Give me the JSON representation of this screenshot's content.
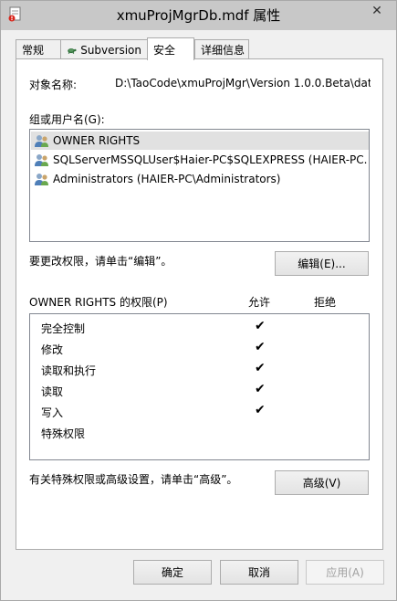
{
  "window": {
    "title": "xmuProjMgrDb.mdf 属性",
    "close_glyph": "✕"
  },
  "tabs": [
    {
      "label": "常规"
    },
    {
      "label": "Subversion"
    },
    {
      "label": "安全",
      "active": true
    },
    {
      "label": "详细信息"
    }
  ],
  "security": {
    "object_label": "对象名称:",
    "object_value": "D:\\TaoCode\\xmuProjMgr\\Version 1.0.0.Beta\\dat",
    "groups_label": "组或用户名(G):",
    "users": [
      {
        "name": "OWNER RIGHTS",
        "selected": true
      },
      {
        "name": "SQLServerMSSQLUser$Haier-PC$SQLEXPRESS (HAIER-PC..."
      },
      {
        "name": "Administrators (HAIER-PC\\Administrators)"
      }
    ],
    "change_hint": "要更改权限，请单击“编辑”。",
    "edit_button": "编辑(E)...",
    "permissions_label": "OWNER RIGHTS 的权限(P)",
    "allow_header": "允许",
    "deny_header": "拒绝",
    "permissions": [
      {
        "name": "完全控制",
        "allow": "✔",
        "deny": ""
      },
      {
        "name": "修改",
        "allow": "✔",
        "deny": ""
      },
      {
        "name": "读取和执行",
        "allow": "✔",
        "deny": ""
      },
      {
        "name": "读取",
        "allow": "✔",
        "deny": ""
      },
      {
        "name": "写入",
        "allow": "✔",
        "deny": ""
      },
      {
        "name": "特殊权限",
        "allow": "",
        "deny": ""
      }
    ],
    "advanced_hint": "有关特殊权限或高级设置，请单击“高级”。",
    "advanced_button": "高级(V)"
  },
  "footer": {
    "ok": "确定",
    "cancel": "取消",
    "apply": "应用(A)"
  }
}
